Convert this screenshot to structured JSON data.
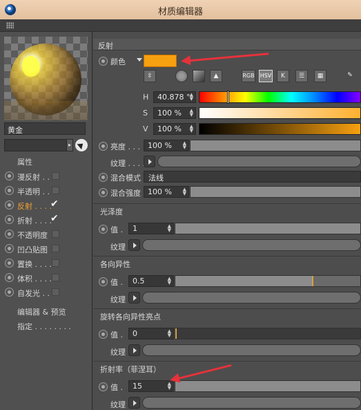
{
  "window": {
    "title": "材质编辑器"
  },
  "left": {
    "material_name": "黄金",
    "section_label": "属性",
    "channels": [
      {
        "label": "漫反射 . .",
        "checked": false,
        "active": false
      },
      {
        "label": "半透明 . .",
        "checked": false,
        "active": false
      },
      {
        "label": "反射 . . . .",
        "checked": true,
        "active": true
      },
      {
        "label": "折射 . . . .",
        "checked": true,
        "active": false
      },
      {
        "label": "不透明度",
        "checked": false,
        "active": false
      },
      {
        "label": "凹凸贴图",
        "checked": false,
        "active": false
      },
      {
        "label": "置换 . . . .",
        "checked": false,
        "active": false
      },
      {
        "label": "体积 . . . .",
        "checked": false,
        "active": false
      },
      {
        "label": "自发光 . .",
        "checked": false,
        "active": false
      }
    ],
    "editor_preview": "编辑器 & 预览",
    "assign": "指定 . . . . . . . ."
  },
  "reflection": {
    "header": "反射",
    "color_label": "颜色",
    "color_value": "#f7a010",
    "color_tools": [
      "RGB",
      "HSV",
      "K"
    ],
    "h_label": "H",
    "h_value": "40.878 °",
    "s_label": "S",
    "s_value": "100 %",
    "v_label": "V",
    "v_value": "100 %",
    "brightness_label": "亮度 . . .",
    "brightness_value": "100 %",
    "texture_label": "纹理 . . . .",
    "blend_mode_label": "混合模式",
    "blend_mode_value": "法线",
    "blend_strength_label": "混合强度",
    "blend_strength_value": "100 %"
  },
  "gloss": {
    "header": "光泽度",
    "value_label": "值 .",
    "value": "1",
    "texture_label": "纹理"
  },
  "anisotropy": {
    "header": "各向异性",
    "value_label": "值 .",
    "value": "0.5",
    "texture_label": "纹理"
  },
  "rotate": {
    "header": "旋转各向异性亮点",
    "value_label": "值 .",
    "value": "0",
    "texture_label": "纹理"
  },
  "fresnel": {
    "header": "折射率（菲涅耳）",
    "value_label": "值 .",
    "value": "15",
    "texture_label": "纹理"
  }
}
